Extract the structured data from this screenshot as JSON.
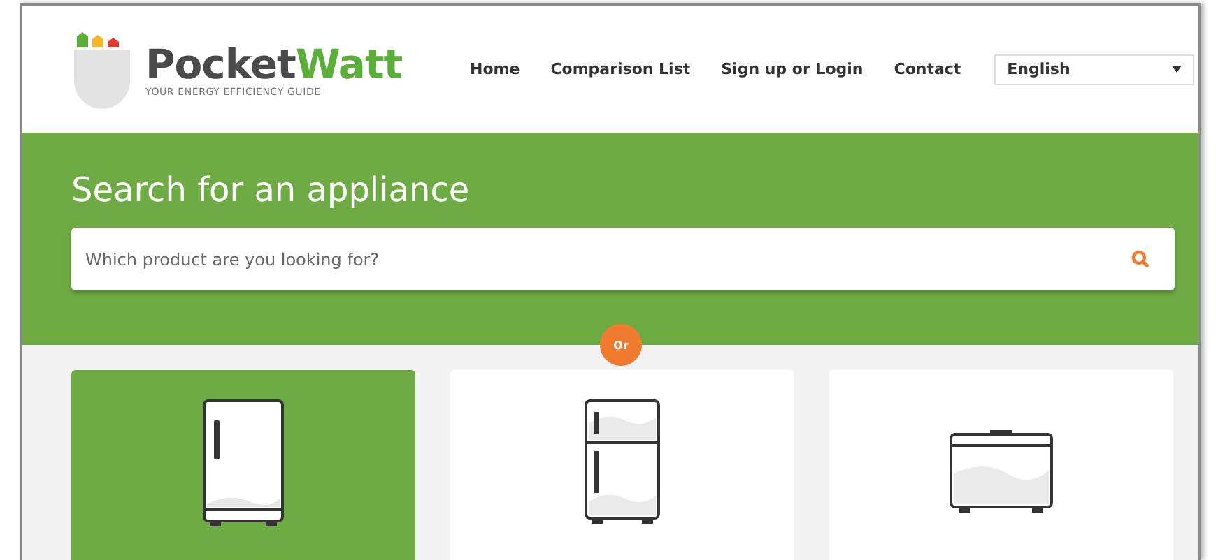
{
  "logo": {
    "name_dark": "Pocket",
    "name_green": "Watt",
    "tagline": "YOUR ENERGY EFFICIENCY GUIDE"
  },
  "nav": [
    "Home",
    "Comparison List",
    "Sign up or Login",
    "Contact"
  ],
  "language": {
    "value": "English"
  },
  "hero": {
    "title": "Search for an appliance",
    "search": {
      "placeholder": "Which product are you looking for?"
    },
    "divider": "Or"
  },
  "categories": [
    {
      "kind": "fridge",
      "selected": true
    },
    {
      "kind": "fridge-freezer",
      "selected": false
    },
    {
      "kind": "chest-freezer",
      "selected": false
    }
  ]
}
